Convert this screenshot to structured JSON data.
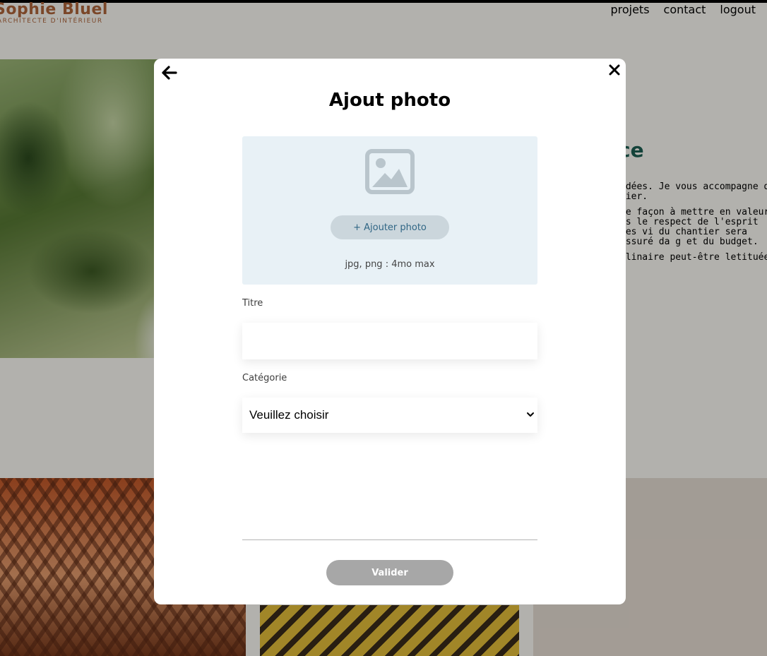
{
  "header": {
    "logo_name": "Sophie Bluel",
    "logo_sub": "ARCHITECTE D'INTÉRIEUR",
    "nav": [
      "projets",
      "contact",
      "logout"
    ]
  },
  "intro": {
    "title_fragment": "ce",
    "paragraphs": [
      "idées. Je vous accompagne d tier.",
      "de façon à mettre en valeur ns le respect de l'esprit des vi du chantier sera assuré da g et du budget.",
      "olinaire peut-être letituée :"
    ]
  },
  "modal": {
    "title": "Ajout photo",
    "back_icon": "arrow-left-icon",
    "close_icon": "close-icon",
    "upload": {
      "icon": "image-icon",
      "button_label": "+ Ajouter photo",
      "hint": "jpg, png : 4mo max"
    },
    "title_field": {
      "label": "Titre",
      "value": ""
    },
    "category_field": {
      "label": "Catégorie",
      "selected": "Veuillez choisir"
    },
    "submit_label": "Valider"
  },
  "colors": {
    "brand": "#b1663c",
    "accent_green": "#1d6154",
    "upload_bg": "#e8f1f6",
    "upload_button_bg": "#cbd6dc",
    "upload_button_text": "#306685",
    "submit_disabled": "#a7a7a7"
  }
}
